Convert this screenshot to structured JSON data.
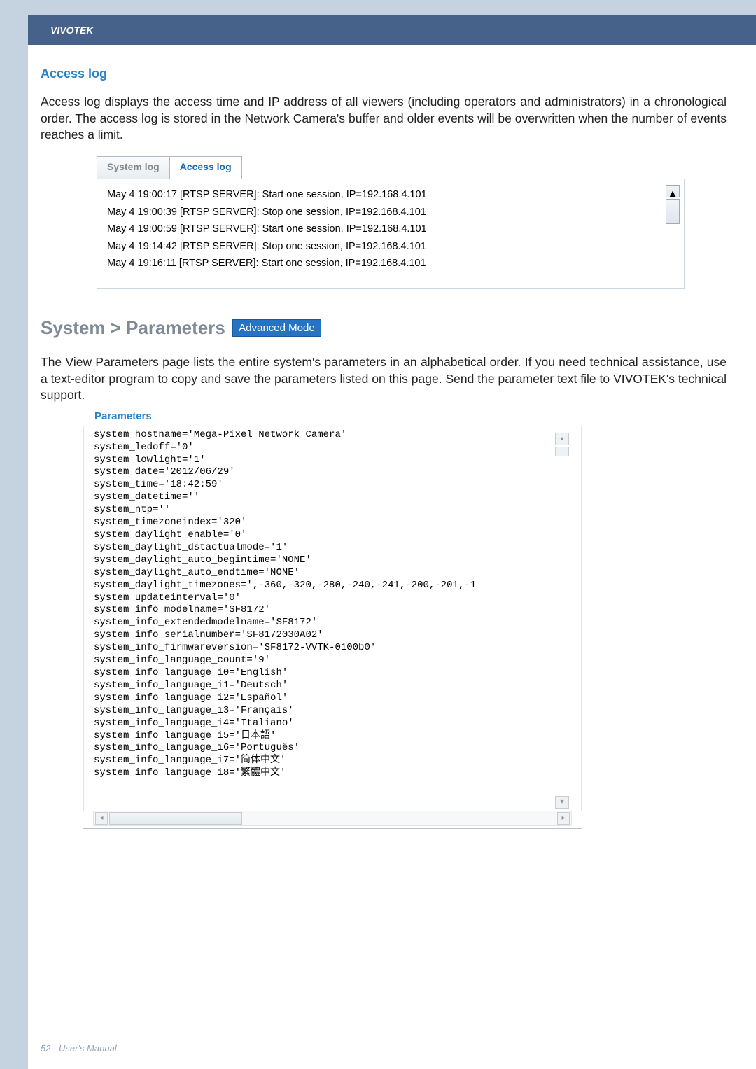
{
  "header": {
    "brand": "VIVOTEK"
  },
  "access_log": {
    "heading": "Access log",
    "para": "Access log displays the access time and IP address of all viewers (including operators and administrators) in a chronological order. The access log is stored in the Network Camera's buffer and older events will be overwritten when the number of events reaches a limit.",
    "tabs": {
      "system": "System log",
      "access": "Access log"
    },
    "lines": [
      "May 4 19:00:17 [RTSP SERVER]: Start one session, IP=192.168.4.101",
      "May 4 19:00:39 [RTSP SERVER]: Stop one session, IP=192.168.4.101",
      "May 4 19:00:59 [RTSP SERVER]: Start one session, IP=192.168.4.101",
      "May 4 19:14:42 [RTSP SERVER]: Stop one session, IP=192.168.4.101",
      "May 4 19:16:11 [RTSP SERVER]: Start one session, IP=192.168.4.101"
    ]
  },
  "parameters": {
    "heading": "System > Parameters",
    "badge": "Advanced Mode",
    "para": "The View Parameters page lists the entire system's parameters in an alphabetical order. If you need technical assistance, use a text-editor program to copy and save the parameters listed on this page. Send the parameter text file to VIVOTEK's technical support.",
    "legend": "Parameters",
    "text": "system_hostname='Mega-Pixel Network Camera'\nsystem_ledoff='0'\nsystem_lowlight='1'\nsystem_date='2012/06/29'\nsystem_time='18:42:59'\nsystem_datetime=''\nsystem_ntp=''\nsystem_timezoneindex='320'\nsystem_daylight_enable='0'\nsystem_daylight_dstactualmode='1'\nsystem_daylight_auto_begintime='NONE'\nsystem_daylight_auto_endtime='NONE'\nsystem_daylight_timezones=',-360,-320,-280,-240,-241,-200,-201,-1\nsystem_updateinterval='0'\nsystem_info_modelname='SF8172'\nsystem_info_extendedmodelname='SF8172'\nsystem_info_serialnumber='SF8172030A02'\nsystem_info_firmwareversion='SF8172-VVTK-0100b0'\nsystem_info_language_count='9'\nsystem_info_language_i0='English'\nsystem_info_language_i1='Deutsch'\nsystem_info_language_i2='Español'\nsystem_info_language_i3='Français'\nsystem_info_language_i4='Italiano'\nsystem_info_language_i5='日本語'\nsystem_info_language_i6='Português'\nsystem_info_language_i7='简体中文'\nsystem_info_language_i8='繁體中文'"
  },
  "chart_data": {
    "type": "table",
    "title": "Parameters",
    "rows": [
      {
        "key": "system_hostname",
        "value": "Mega-Pixel Network Camera"
      },
      {
        "key": "system_ledoff",
        "value": "0"
      },
      {
        "key": "system_lowlight",
        "value": "1"
      },
      {
        "key": "system_date",
        "value": "2012/06/29"
      },
      {
        "key": "system_time",
        "value": "18:42:59"
      },
      {
        "key": "system_datetime",
        "value": ""
      },
      {
        "key": "system_ntp",
        "value": ""
      },
      {
        "key": "system_timezoneindex",
        "value": "320"
      },
      {
        "key": "system_daylight_enable",
        "value": "0"
      },
      {
        "key": "system_daylight_dstactualmode",
        "value": "1"
      },
      {
        "key": "system_daylight_auto_begintime",
        "value": "NONE"
      },
      {
        "key": "system_daylight_auto_endtime",
        "value": "NONE"
      },
      {
        "key": "system_daylight_timezones",
        "value": ",-360,-320,-280,-240,-241,-200,-201,-1"
      },
      {
        "key": "system_updateinterval",
        "value": "0"
      },
      {
        "key": "system_info_modelname",
        "value": "SF8172"
      },
      {
        "key": "system_info_extendedmodelname",
        "value": "SF8172"
      },
      {
        "key": "system_info_serialnumber",
        "value": "SF8172030A02"
      },
      {
        "key": "system_info_firmwareversion",
        "value": "SF8172-VVTK-0100b0"
      },
      {
        "key": "system_info_language_count",
        "value": "9"
      },
      {
        "key": "system_info_language_i0",
        "value": "English"
      },
      {
        "key": "system_info_language_i1",
        "value": "Deutsch"
      },
      {
        "key": "system_info_language_i2",
        "value": "Español"
      },
      {
        "key": "system_info_language_i3",
        "value": "Français"
      },
      {
        "key": "system_info_language_i4",
        "value": "Italiano"
      },
      {
        "key": "system_info_language_i5",
        "value": "日本語"
      },
      {
        "key": "system_info_language_i6",
        "value": "Português"
      },
      {
        "key": "system_info_language_i7",
        "value": "简体中文"
      },
      {
        "key": "system_info_language_i8",
        "value": "繁體中文"
      }
    ]
  },
  "footer": {
    "text": "52 - User's Manual"
  }
}
